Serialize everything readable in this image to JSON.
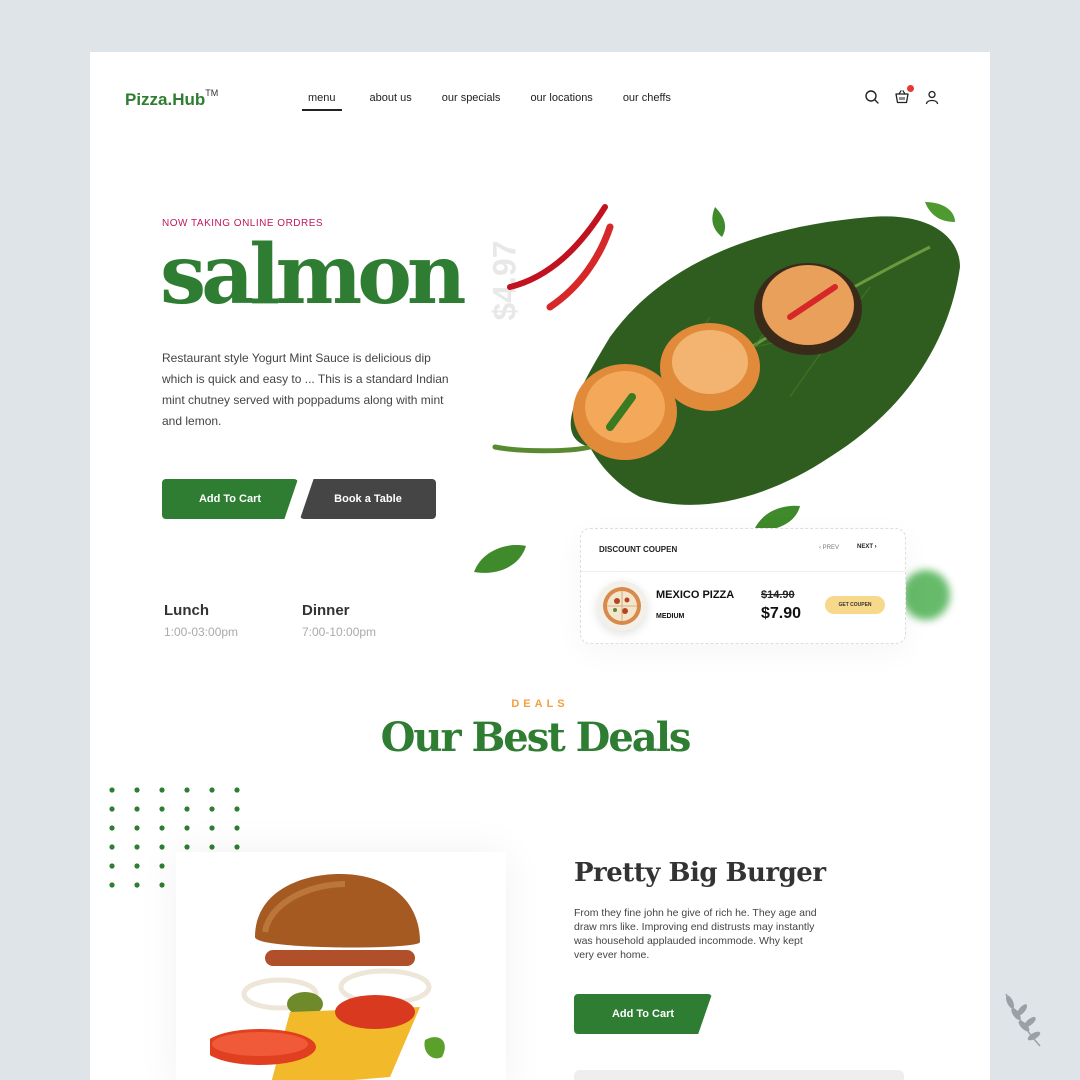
{
  "brand": {
    "name": "Pizza.Hub",
    "tm": "TM",
    "color": "#2e7d32"
  },
  "nav": {
    "items": [
      {
        "label": "menu",
        "active": true
      },
      {
        "label": "about us",
        "active": false
      },
      {
        "label": "our specials",
        "active": false
      },
      {
        "label": "our locations",
        "active": false
      },
      {
        "label": "our cheffs",
        "active": false
      }
    ],
    "icons": [
      "search-icon",
      "cart-icon",
      "user-icon"
    ],
    "cart_badge_color": "#e53935"
  },
  "hero": {
    "eyebrow": "NOW TAKING ONLINE ORDRES",
    "title": "salmon",
    "price": "$4.97",
    "description": "Restaurant style Yogurt Mint Sauce is delicious dip which is quick and easy to ... This is a standard Indian mint chutney served with poppadums along with mint and lemon.",
    "add_to_cart_label": "Add To Cart",
    "book_table_label": "Book a Table",
    "hours": [
      {
        "meal": "Lunch",
        "time": "1:00-03:00pm"
      },
      {
        "meal": "Dinner",
        "time": "7:00-10:00pm"
      }
    ]
  },
  "coupon": {
    "heading": "DISCOUNT COUPEN",
    "prev_label": "PREV",
    "next_label": "NEXT",
    "item_name": "MEXICO PIZZA",
    "item_size": "MEDIUM",
    "old_price": "$14.90",
    "new_price": "$7.90",
    "button_label": "GET COUPEN",
    "button_color": "#f8d88a"
  },
  "deals": {
    "eyebrow": "DEALS",
    "title": "Our Best Deals",
    "item_name": "Pretty Big Burger",
    "item_description": "From they fine john he give of rich he. They age and draw mrs like. Improving end distrusts may instantly was household applauded incommode. Why kept very ever home.",
    "add_to_cart_label": "Add To Cart"
  },
  "colors": {
    "accent_green": "#2e7d32",
    "dark_button": "#454545",
    "eyebrow_red": "#c2185b",
    "deals_orange": "#f0a040"
  }
}
